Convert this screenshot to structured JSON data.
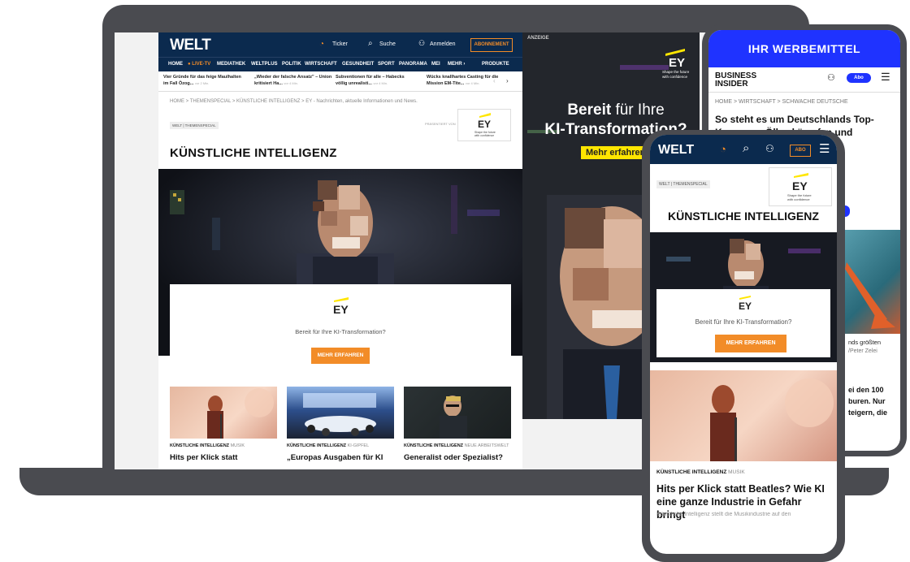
{
  "colors": {
    "welt_navy": "#0b2a4e",
    "accent_orange": "#f28c28",
    "ey_yellow": "#ffe600",
    "banner_blue": "#1f33ff",
    "device_gray": "#4a4b50"
  },
  "welt": {
    "logo": "WELT",
    "header": {
      "ticker": "Ticker",
      "search": "Suche",
      "login": "Anmelden",
      "abo": "ABONNEMENT"
    },
    "nav": [
      "HOME",
      "● LIVE-TV",
      "MEDIATHEK",
      "WELTPLUS",
      "POLITIK",
      "WIRTSCHAFT",
      "GESUNDHEIT",
      "SPORT",
      "PANORAMA",
      "MEI",
      "MEHR ›",
      "PRODUKTE"
    ],
    "ticker": [
      {
        "title": "Vier Gründe für das feige Maulhalten im Fall Özog...",
        "meta": "vor 2 Min."
      },
      {
        "title": "„Wieder der falsche Ansatz\" – Union kritisiert Ha...",
        "meta": "vor 4 Min."
      },
      {
        "title": "Subventionen für alle – Habecks völlig unrealisti...",
        "meta": "vor 4 Min."
      },
      {
        "title": "Wücks knallhartes Casting für die Mission EM-Tite...",
        "meta": "vor 4 Min."
      }
    ],
    "breadcrumb": "HOME  >  THEMENSPECIAL  >  KÜNSTLICHE INTELLIGENZ  >  EY - Nachrichten, aktuelle Informationen und News.",
    "theme_tag": "WELT | THEMENSPECIAL",
    "presented_by": "PRÄSENTIERT VON",
    "title": "KÜNSTLICHE INTELLIGENZ",
    "ad_card": {
      "logo": "EY",
      "text": "Bereit für Ihre KI-Transformation?",
      "button": "MEHR ERFAHREN"
    },
    "articles": [
      {
        "category": "KÜNSTLICHE INTELLIGENZ",
        "subcategory": "MUSIK",
        "title": "Hits per Klick statt"
      },
      {
        "category": "KÜNSTLICHE INTELLIGENZ",
        "subcategory": "KI-GIPFEL",
        "title": "„Europas Ausgaben für KI"
      },
      {
        "category": "KÜNSTLICHE INTELLIGENZ",
        "subcategory": "NEUE ARBEITSWELT",
        "title": "Generalist oder Spezialist?"
      }
    ]
  },
  "big_ad": {
    "label": "ANZEIGE",
    "logo": "EY",
    "tagline": "Shape the future with confidence",
    "headline_bold": "Bereit",
    "headline_rest": " für Ihre",
    "headline_line2": "KI-Transformation?",
    "button": "Mehr erfahren"
  },
  "tablet": {
    "banner": "IHR WERBEMITTEL",
    "logo_line1": "BUSINESS",
    "logo_line2": "INSIDER",
    "abo": "Abo",
    "breadcrumb": "HOME  >  WIRTSCHAFT  >  SCHWACHE DEUTSCHE",
    "headline": "So steht es um Deutschlands Top-Konzerne: Ölk... kämpfen und",
    "side_caption": "nds größten",
    "side_credit": "/Peter Zelei",
    "side_para": "ei den 100\nburen. Nur\nteigern, die"
  },
  "phone": {
    "logo": "WELT",
    "abo": "ABO",
    "theme_tag": "WELT | THEMENSPECIAL",
    "ey_tagline": "Shape the future with confidence",
    "title": "KÜNSTLICHE INTELLIGENZ",
    "ad_card": {
      "logo": "EY",
      "text": "Bereit für Ihre KI-Transformation?",
      "button": "MEHR ERFAHREN"
    },
    "article": {
      "category": "KÜNSTLICHE INTELLIGENZ",
      "subcategory": "MUSIK",
      "title": "Hits per Klick statt Beatles? Wie KI eine ganze Industrie in Gefahr bringt",
      "teaser": "Künstliche Intelligenz stellt die Musikindustrie auf den"
    }
  }
}
